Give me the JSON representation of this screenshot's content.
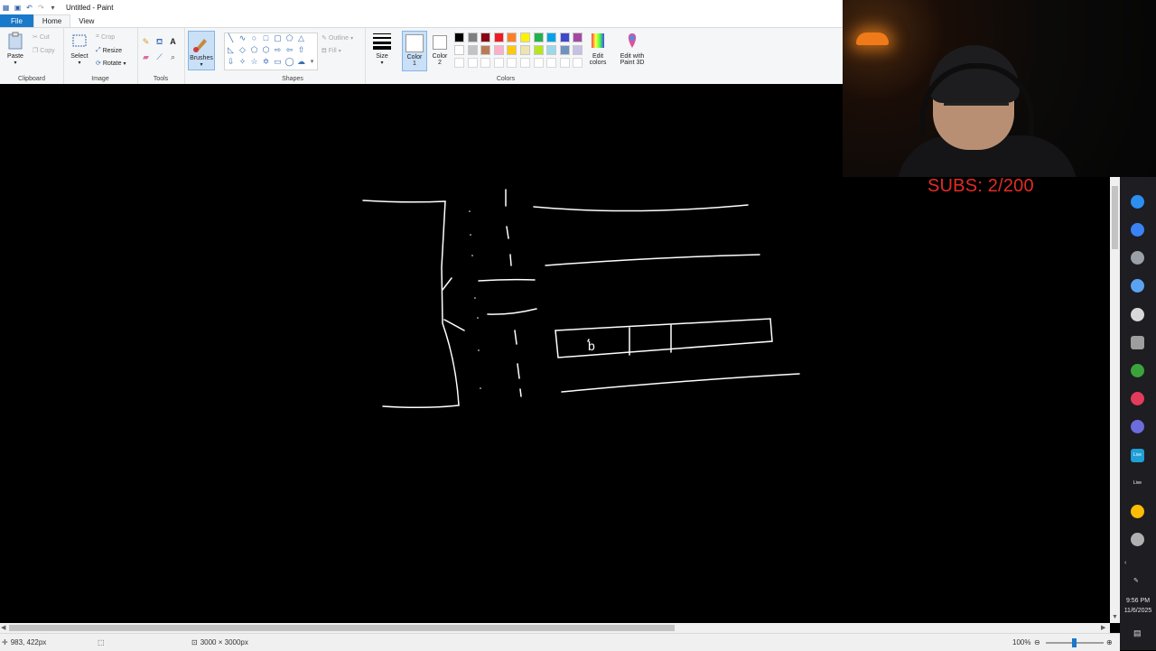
{
  "window": {
    "title": "Untitled - Paint"
  },
  "menu": {
    "tabs": [
      "File",
      "Home",
      "View"
    ]
  },
  "ribbon": {
    "clipboard": {
      "paste": "Paste",
      "cut": "Cut",
      "copy": "Copy",
      "label": "Clipboard"
    },
    "image": {
      "select": "Select",
      "crop": "Crop",
      "resize": "Resize",
      "rotate": "Rotate",
      "label": "Image"
    },
    "tools": {
      "label": "Tools"
    },
    "brushes": {
      "label": "Brushes"
    },
    "shapes": {
      "outline": "Outline",
      "fill": "Fill",
      "label": "Shapes"
    },
    "size": {
      "label": "Size"
    },
    "color1": {
      "label1": "Color",
      "label2": "1"
    },
    "color2": {
      "label1": "Color",
      "label2": "2"
    },
    "colors": {
      "label": "Colors",
      "row1": [
        "#000000",
        "#7f7f7f",
        "#880015",
        "#ed1c24",
        "#ff7f27",
        "#fff200",
        "#22b14c",
        "#00a2e8",
        "#3f48cc",
        "#a349a4"
      ],
      "row2": [
        "#ffffff",
        "#c3c3c3",
        "#b97a57",
        "#ffaec9",
        "#ffc90e",
        "#efe4b0",
        "#b5e61d",
        "#99d9ea",
        "#7092be",
        "#c8bfe7"
      ]
    },
    "edit_colors": {
      "label1": "Edit",
      "label2": "colors"
    },
    "paint3d": {
      "label1": "Edit with",
      "label2": "Paint 3D"
    }
  },
  "canvas": {
    "letter": "b"
  },
  "overlay": {
    "subs": "SUBS: 2/200"
  },
  "taskbar": {
    "time": "9:56 PM",
    "date": "11/6/2025",
    "live1": "Live",
    "live2": "Live"
  },
  "status": {
    "cursor": "983, 422px",
    "dimensions": "3000 × 3000px",
    "zoom": "100%"
  }
}
